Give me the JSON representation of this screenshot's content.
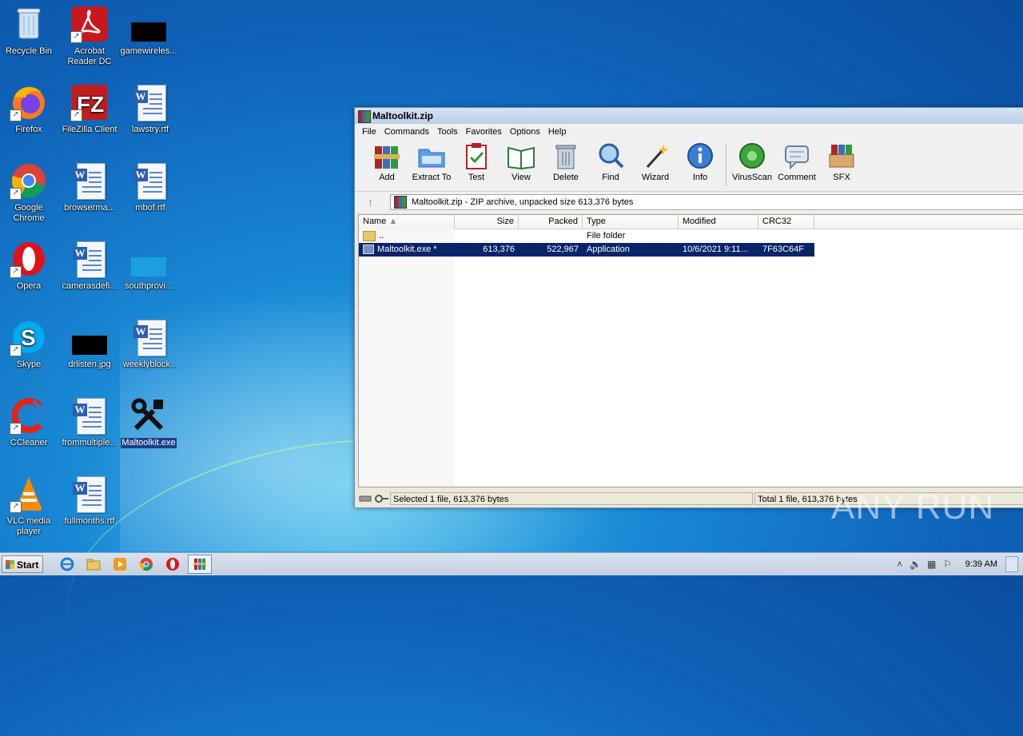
{
  "desktop": {
    "icons": [
      {
        "label": "Recycle Bin",
        "icon": "recycle-bin-icon"
      },
      {
        "label": "Acrobat Reader DC",
        "icon": "acrobat-reader-icon"
      },
      {
        "label": "gamewireles...",
        "icon": "black-thumbnail-icon"
      },
      {
        "label": "Firefox",
        "icon": "firefox-icon"
      },
      {
        "label": "FileZilla Client",
        "icon": "filezilla-icon"
      },
      {
        "label": "lawstry.rtf",
        "icon": "word-document-icon"
      },
      {
        "label": "Google Chrome",
        "icon": "chrome-icon"
      },
      {
        "label": "browserma...",
        "icon": "word-document-icon"
      },
      {
        "label": "mbof.rtf",
        "icon": "word-document-icon"
      },
      {
        "label": "Opera",
        "icon": "opera-icon"
      },
      {
        "label": "camerasdefi...",
        "icon": "word-document-icon"
      },
      {
        "label": "southprovi...",
        "icon": "blue-thumbnail-icon"
      },
      {
        "label": "Skype",
        "icon": "skype-icon"
      },
      {
        "label": "drlisten.jpg",
        "icon": "black-thumbnail-icon"
      },
      {
        "label": "weeklyblock...",
        "icon": "word-document-icon"
      },
      {
        "label": "CCleaner",
        "icon": "ccleaner-icon"
      },
      {
        "label": "frommultiple...",
        "icon": "word-document-icon"
      },
      {
        "label": "Maltoolkit.exe",
        "icon": "tools-icon"
      },
      {
        "label": "VLC media player",
        "icon": "vlc-icon"
      },
      {
        "label": "fullmonths.rtf",
        "icon": "word-document-icon"
      }
    ]
  },
  "window": {
    "title": "Maltoolkit.zip",
    "menu": [
      "File",
      "Commands",
      "Tools",
      "Favorites",
      "Options",
      "Help"
    ],
    "toolbar": [
      "Add",
      "Extract To",
      "Test",
      "View",
      "Delete",
      "Find",
      "Wizard",
      "Info",
      "VirusScan",
      "Comment",
      "SFX"
    ],
    "address": "Maltoolkit.zip - ZIP archive, unpacked size 613,376 bytes",
    "columns": [
      "Name",
      "Size",
      "Packed",
      "Type",
      "Modified",
      "CRC32"
    ],
    "rows": [
      {
        "name": "..",
        "size": "",
        "packed": "",
        "type": "File folder",
        "modified": "",
        "crc": ""
      },
      {
        "name": "Maltoolkit.exe *",
        "size": "613,376",
        "packed": "522,967",
        "type": "Application",
        "modified": "10/6/2021 9:11...",
        "crc": "7F63C64F"
      }
    ],
    "status_left": "Selected 1 file, 613,376 bytes",
    "status_right": "Total 1 file, 613,376 bytes"
  },
  "taskbar": {
    "start_label": "Start",
    "clock": "9:39 AM"
  },
  "watermark": "ANY RUN"
}
